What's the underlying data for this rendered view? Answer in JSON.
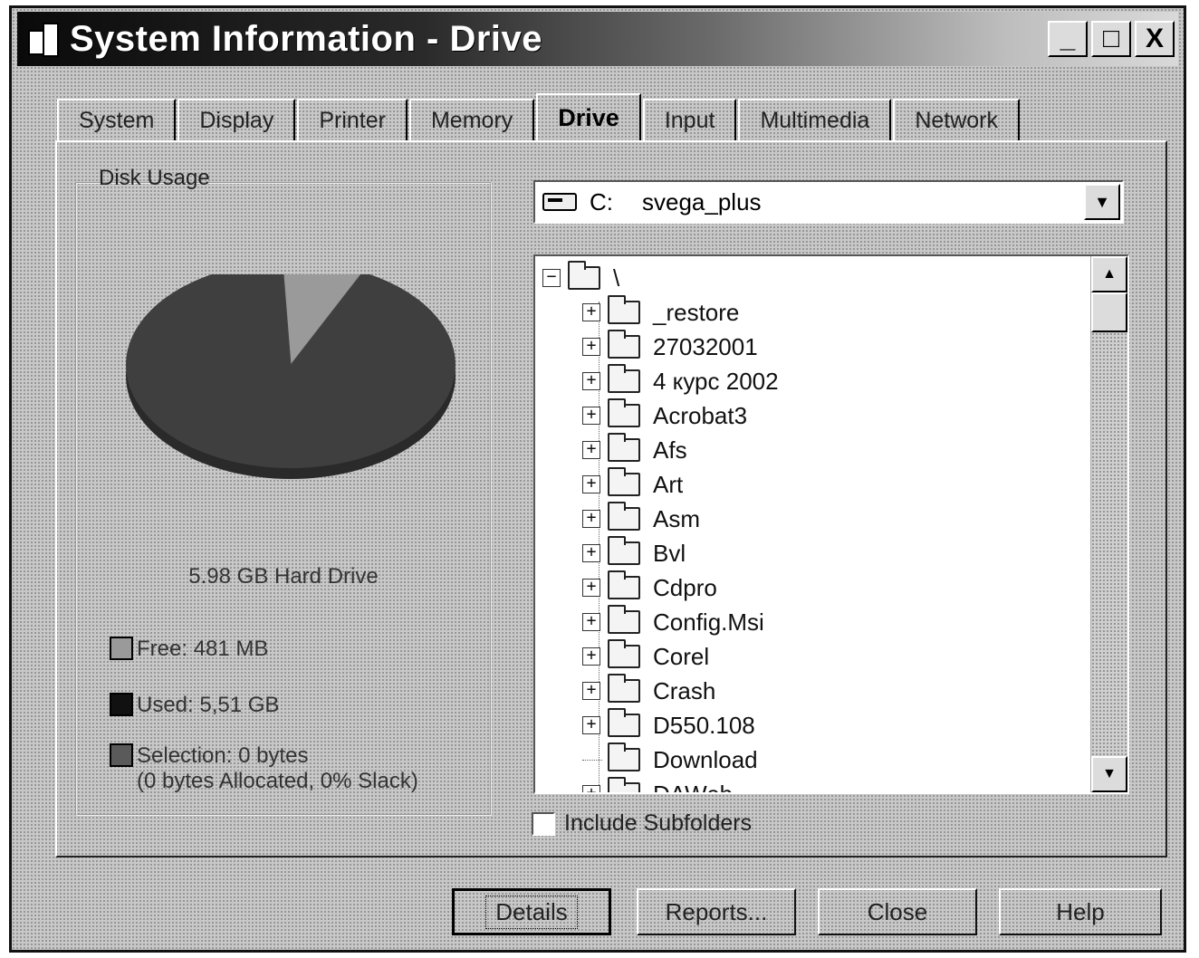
{
  "window": {
    "title": "System Information - Drive"
  },
  "titlebar_buttons": {
    "minimize": "_",
    "maximize": "□",
    "close": "X"
  },
  "tabs": [
    {
      "label": "System"
    },
    {
      "label": "Display"
    },
    {
      "label": "Printer"
    },
    {
      "label": "Memory"
    },
    {
      "label": "Drive",
      "active": true
    },
    {
      "label": "Input"
    },
    {
      "label": "Multimedia"
    },
    {
      "label": "Network"
    }
  ],
  "disk_usage": {
    "group_label": "Disk Usage",
    "drive_label": "5.98 GB Hard Drive",
    "free_label": "Free: 481  MB",
    "used_label": "Used: 5,51 GB",
    "selection_label": "Selection: 0 bytes",
    "selection_detail": "(0 bytes Allocated, 0% Slack)",
    "free_fraction": 0.08
  },
  "drive_select": {
    "letter": "C:",
    "name": "svega_plus"
  },
  "tree": {
    "root": "\\",
    "items": [
      {
        "label": "_restore",
        "expander": "+"
      },
      {
        "label": "27032001",
        "expander": "+"
      },
      {
        "label": "4 курс 2002",
        "expander": "+"
      },
      {
        "label": "Acrobat3",
        "expander": "+"
      },
      {
        "label": "Afs",
        "expander": "+"
      },
      {
        "label": "Art",
        "expander": "+"
      },
      {
        "label": "Asm",
        "expander": "+"
      },
      {
        "label": "Bvl",
        "expander": "+"
      },
      {
        "label": "Cdpro",
        "expander": "+"
      },
      {
        "label": "Config.Msi",
        "expander": "+"
      },
      {
        "label": "Corel",
        "expander": "+"
      },
      {
        "label": "Crash",
        "expander": "+"
      },
      {
        "label": "D550.108",
        "expander": "+"
      },
      {
        "label": "Download",
        "expander": ""
      },
      {
        "label": "DAWeb",
        "expander": "+"
      }
    ]
  },
  "include_subfolders": {
    "label": "Include Subfolders",
    "checked": false
  },
  "buttons": {
    "details": "Details",
    "reports": "Reports...",
    "close": "Close",
    "help": "Help"
  },
  "colors": {
    "used": "#3f3f3f",
    "free": "#9a9a9a",
    "selection": "#5a5a5a"
  }
}
